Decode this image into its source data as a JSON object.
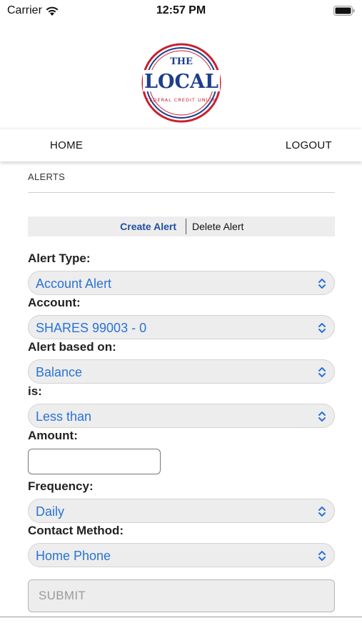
{
  "status_bar": {
    "carrier": "Carrier",
    "time": "12:57 PM"
  },
  "logo": {
    "line1": "THE",
    "line2": "LOCAL",
    "tagline": "FEDERAL CREDIT UNION",
    "red": "#c8202f",
    "blue": "#1e3e8c"
  },
  "nav": {
    "home": "HOME",
    "logout": "LOGOUT"
  },
  "section": {
    "title": "ALERTS"
  },
  "tabs": {
    "create": "Create Alert",
    "delete": "Delete Alert"
  },
  "form": {
    "alert_type_label": "Alert Type:",
    "alert_type_value": "Account Alert",
    "account_label": "Account:",
    "account_value": "SHARES 99003 - 0",
    "based_on_label": "Alert based on:",
    "based_on_value": "Balance",
    "is_label": "is:",
    "is_value": "Less than",
    "amount_label": "Amount:",
    "amount_value": "",
    "frequency_label": "Frequency:",
    "frequency_value": "Daily",
    "contact_label": "Contact Method:",
    "contact_value": "Home Phone",
    "submit_label": "SUBMIT"
  },
  "colors": {
    "link": "#2a73d6",
    "accent": "#1f4fa3"
  }
}
